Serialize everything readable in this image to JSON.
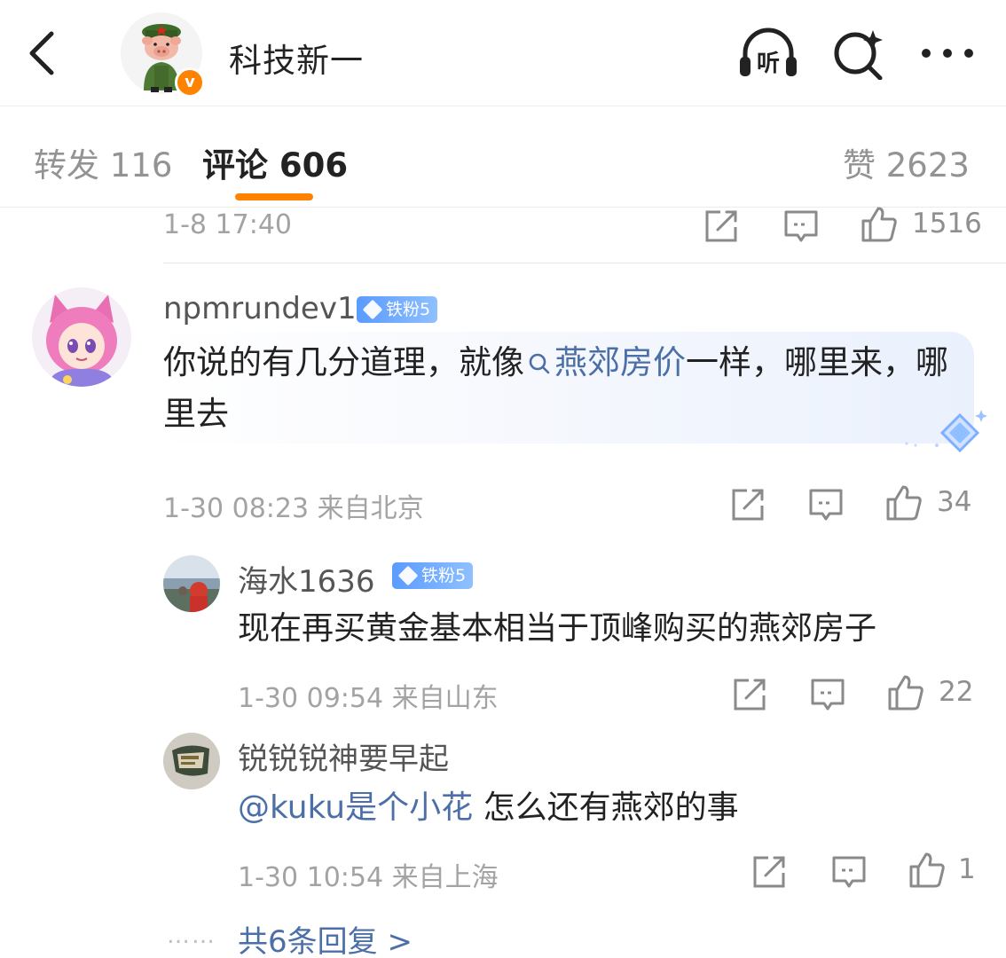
{
  "header": {
    "title": "科技新一",
    "verified_mark": "v",
    "listen_label": "听",
    "icons": [
      "back-arrow-icon",
      "listen-headphones-icon",
      "search-sparkle-icon",
      "more-dots-icon"
    ]
  },
  "tabs": {
    "repost_label": "转发",
    "repost_count": "116",
    "comment_label": "评论",
    "comment_count": "606",
    "like_label": "赞",
    "like_count": "2623",
    "active": "comment",
    "accent_color": "#ff8200"
  },
  "prev_comment": {
    "time": "1-8 17:40",
    "likes": "1516"
  },
  "comments": [
    {
      "username": "npmrundev1",
      "fan_badge": "铁粉5",
      "text_before": "你说的有几分道理，就像",
      "topic": "燕郊房价",
      "text_after": "一样，哪里来，哪里去",
      "time": "1-30 08:23",
      "location": "来自北京",
      "likes": "34",
      "replies": [
        {
          "username": "海水1636",
          "fan_badge": "铁粉5",
          "text": "现在再买黄金基本相当于顶峰购买的燕郊房子",
          "time": "1-30 09:54",
          "location": "来自山东",
          "likes": "22"
        },
        {
          "username": "锐锐锐神要早起",
          "mention": "@kuku是个小花",
          "text": "怎么还有燕郊的事",
          "time": "1-30 10:54",
          "location": "来自上海",
          "likes": "1"
        }
      ],
      "more_replies": "共6条回复 >",
      "more_dots": "……"
    }
  ],
  "colors": {
    "link_blue": "#4b6fa6",
    "meta_grey": "#a3a3a3",
    "fan_badge_blue": "#5a9bff"
  }
}
